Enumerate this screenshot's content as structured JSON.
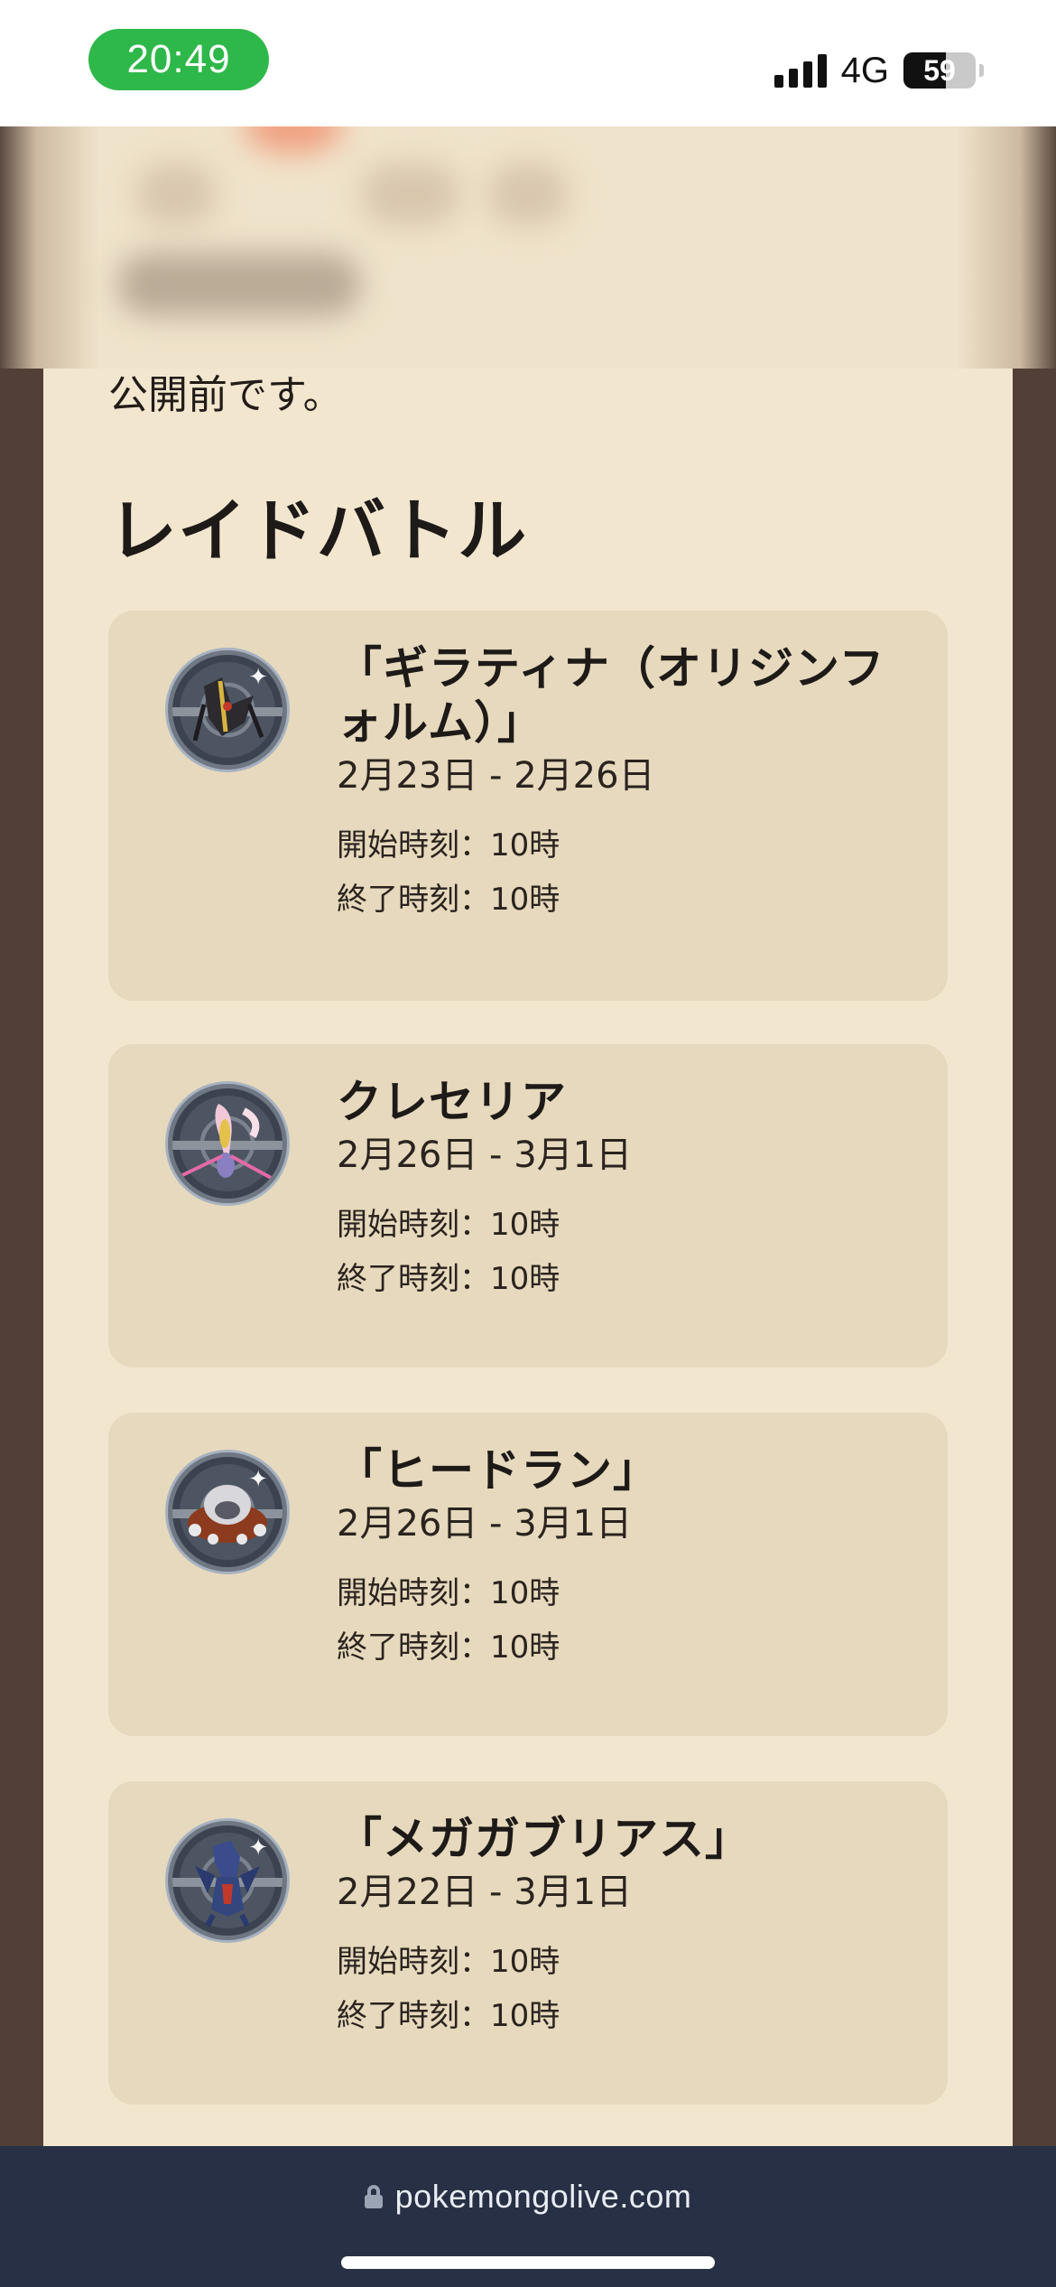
{
  "status_bar": {
    "time": "20:49",
    "network": "4G",
    "battery": "59",
    "battery_level": 0.59
  },
  "page": {
    "intro_text": "公開前です。",
    "section_title": "レイドバトル"
  },
  "raids": [
    {
      "name": "「ギラティナ（オリジンフォルム）」",
      "dates": "2月23日 - 2月26日",
      "start": "開始時刻：10時",
      "end": "終了時刻：10時",
      "icon": "giratina-origin-icon"
    },
    {
      "name": "クレセリア",
      "dates": "2月26日 - 3月1日",
      "start": "開始時刻：10時",
      "end": "終了時刻：10時",
      "icon": "cresselia-icon"
    },
    {
      "name": "「ヒードラン」",
      "dates": "2月26日 - 3月1日",
      "start": "開始時刻：10時",
      "end": "終了時刻：10時",
      "icon": "heatran-icon"
    },
    {
      "name": "「メガガブリアス」",
      "dates": "2月22日 - 3月1日",
      "start": "開始時刻：10時",
      "end": "終了時刻：10時",
      "icon": "mega-garchomp-icon"
    }
  ],
  "browser": {
    "url": "pokemongolive.com"
  },
  "colors": {
    "page_background": "#524038",
    "content_background": "#f2e6cf",
    "card_background": "#e6d9bd",
    "time_pill": "#2fb84a",
    "browser_bar": "#273045"
  }
}
